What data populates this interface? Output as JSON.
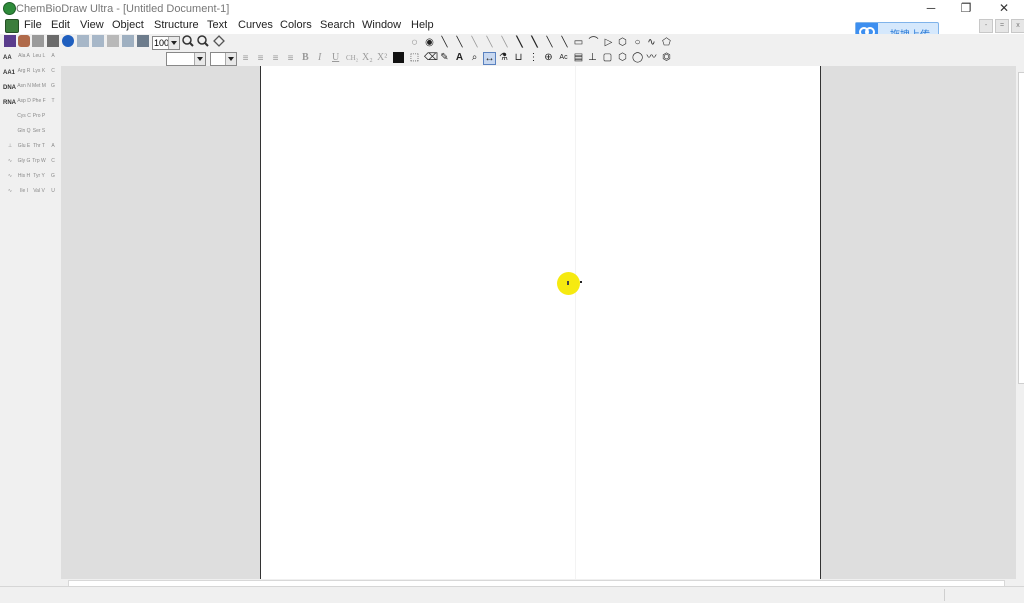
{
  "window": {
    "title": "ChemBioDraw Ultra - [Untitled Document-1]",
    "controls": {
      "minimize": "─",
      "restore": "❐",
      "close": "✕"
    }
  },
  "menu": [
    "File",
    "Edit",
    "View",
    "Object",
    "Structure",
    "Text",
    "Curves",
    "Colors",
    "Search",
    "Window",
    "Help"
  ],
  "mdi_controls": {
    "minimize": "-",
    "restore": "=",
    "close": "x"
  },
  "upload_button": {
    "label": "拖拽上传"
  },
  "toolbar": {
    "zoom_value": "100",
    "font_value": "",
    "size_value": ""
  },
  "format_buttons": {
    "bold": "B",
    "italic": "I",
    "underline": "U",
    "formula": "CH₂",
    "subscript": "X₂",
    "superscript": "X²"
  },
  "palette": [
    {
      "label": "AA",
      "cells": [
        "Ala A",
        "Leu L",
        "A"
      ]
    },
    {
      "label": "AA1",
      "cells": [
        "Arg R",
        "Lys K",
        "C"
      ]
    },
    {
      "label": "DNA",
      "cells": [
        "Asn N",
        "Met M",
        "G"
      ]
    },
    {
      "label": "RNA",
      "cells": [
        "Asp D",
        "Phe F",
        "T"
      ]
    },
    {
      "label": "",
      "cells": [
        "Cys C",
        "Pro P",
        ""
      ]
    },
    {
      "label": "",
      "cells": [
        "Gln Q",
        "Ser S",
        ""
      ]
    },
    {
      "label": "",
      "cells": [
        "Glu E",
        "Thr T",
        "A"
      ]
    },
    {
      "label": "",
      "cells": [
        "Gly G",
        "Trp W",
        "C"
      ]
    },
    {
      "label": "",
      "cells": [
        "His H",
        "Tyr Y",
        "G"
      ]
    },
    {
      "label": "",
      "cells": [
        "Ile I",
        "Val V",
        "U"
      ]
    }
  ]
}
